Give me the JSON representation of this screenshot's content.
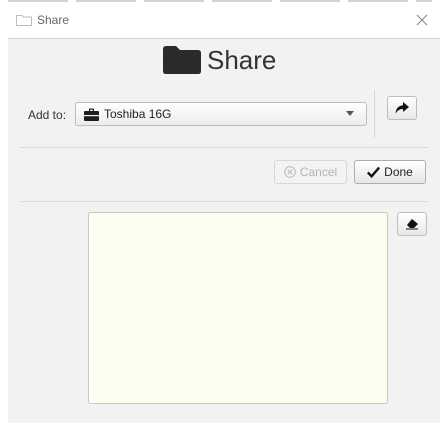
{
  "window": {
    "title": "Share",
    "title_icon": "folder-outline-icon",
    "close_icon": "close-icon"
  },
  "header": {
    "icon": "folder-icon",
    "title": "Share"
  },
  "add_to": {
    "label": "Add to:",
    "selected_icon": "briefcase-icon",
    "selected_value": "Toshiba 16G",
    "caret_icon": "caret-down-icon"
  },
  "share_button": {
    "icon": "share-arrow-icon"
  },
  "actions": {
    "cancel_label": "Cancel",
    "cancel_icon": "cancel-circle-icon",
    "cancel_enabled": false,
    "done_label": "Done",
    "done_icon": "checkmark-icon"
  },
  "notes": {
    "value": "",
    "placeholder": "",
    "erase_icon": "eraser-icon"
  },
  "colors": {
    "panel_bg": "#f2f2f2",
    "textarea_bg": "#fdfdf0",
    "disabled_text": "#b4b4b4"
  }
}
